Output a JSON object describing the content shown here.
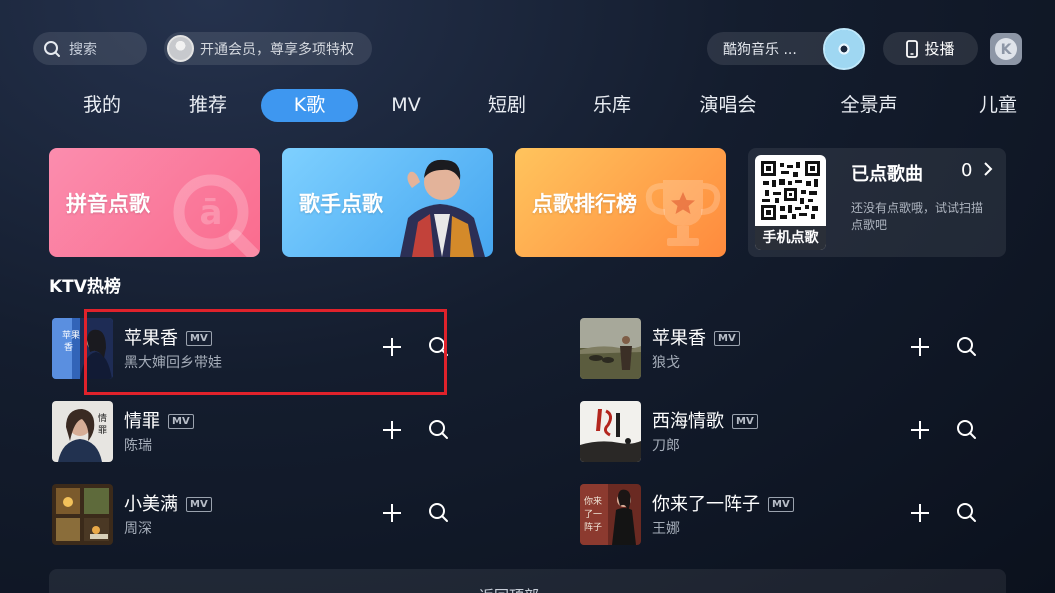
{
  "header": {
    "search_label": "搜索",
    "vip_label": "开通会员，尊享多项特权",
    "player_label": "酷狗音乐 ...",
    "cast_label": "投播",
    "logo_letter": "K"
  },
  "tabs": [
    {
      "label": "我的"
    },
    {
      "label": "推荐"
    },
    {
      "label": "K歌"
    },
    {
      "label": "MV"
    },
    {
      "label": "短剧"
    },
    {
      "label": "乐库"
    },
    {
      "label": "演唱会"
    },
    {
      "label": "全景声"
    },
    {
      "label": "儿童"
    }
  ],
  "active_tab": "K歌",
  "cards": {
    "pinyin": "拼音点歌",
    "singer": "歌手点歌",
    "rank": "点歌排行榜",
    "ordered": {
      "title": "已点歌曲",
      "count": "0",
      "desc": "还没有点歌哦，试试扫描点歌吧",
      "qr_label": "手机点歌"
    }
  },
  "section_title": "KTV热榜",
  "mv_badge": "MV",
  "songs": [
    {
      "name": "苹果香",
      "artist": "黑大婶回乡带娃"
    },
    {
      "name": "苹果香",
      "artist": "狼戈"
    },
    {
      "name": "情罪",
      "artist": "陈瑞"
    },
    {
      "name": "西海情歌",
      "artist": "刀郎"
    },
    {
      "name": "小美满",
      "artist": "周深"
    },
    {
      "name": "你来了一阵子",
      "artist": "王娜"
    }
  ],
  "bottom_bar_label": "返回顶部",
  "colors": {
    "accent": "#3e97f0",
    "highlight": "#e0222b"
  },
  "icons": [
    "search-icon",
    "avatar",
    "disc-icon",
    "phone-icon",
    "add-icon",
    "magnifier-icon",
    "chevron-right-icon"
  ]
}
